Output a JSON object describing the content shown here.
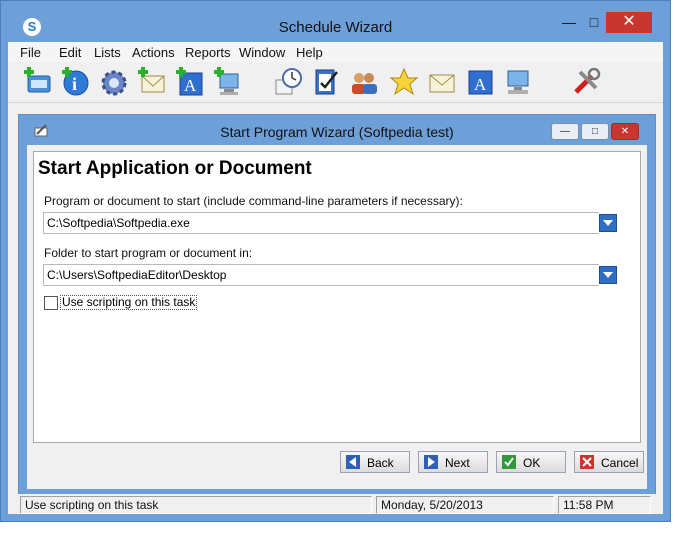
{
  "window": {
    "title": "Schedule Wizard"
  },
  "menu": [
    "File",
    "Edit",
    "Lists",
    "Actions",
    "Reports",
    "Window",
    "Help"
  ],
  "toolbar_icons": [
    "new-task-icon",
    "info-icon",
    "gear-icon",
    "new-email-icon",
    "new-text-icon",
    "new-computer-icon",
    "clock-calendar-icon",
    "checklist-icon",
    "users-icon",
    "star-icon",
    "email-icon",
    "text-icon",
    "computer-icon",
    "tools-icon"
  ],
  "child": {
    "title": "Start Program Wizard  (Softpedia test)",
    "heading": "Start Application or Document",
    "program_label": "Program or document to start (include command-line parameters if necessary):",
    "program_value": "C:\\Softpedia\\Softpedia.exe",
    "folder_label": "Folder to start program or document in:",
    "folder_value": "C:\\Users\\SoftpediaEditor\\Desktop",
    "scripting_label": "Use scripting on this task",
    "scripting_checked": false,
    "buttons": {
      "back": "Back",
      "next": "Next",
      "ok": "OK",
      "cancel": "Cancel"
    }
  },
  "status": {
    "message": "Use scripting on this task",
    "date": "Monday,  5/20/2013",
    "time": "11:58 PM"
  },
  "colors": {
    "frame": "#6d9fd9",
    "close": "#c7372f",
    "accent": "#2d6ec9"
  }
}
